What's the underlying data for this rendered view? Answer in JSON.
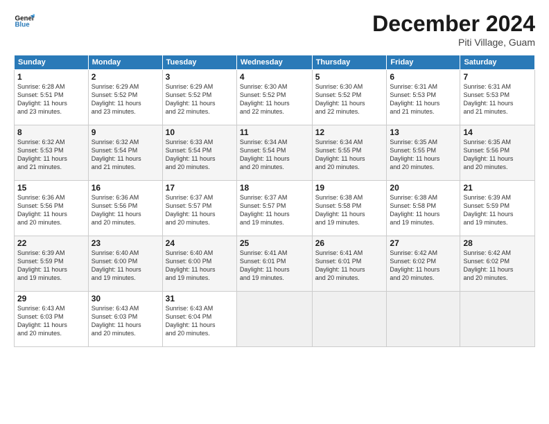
{
  "header": {
    "logo_line1": "General",
    "logo_line2": "Blue",
    "month_title": "December 2024",
    "location": "Piti Village, Guam"
  },
  "days_of_week": [
    "Sunday",
    "Monday",
    "Tuesday",
    "Wednesday",
    "Thursday",
    "Friday",
    "Saturday"
  ],
  "weeks": [
    [
      {
        "day": "1",
        "info": "Sunrise: 6:28 AM\nSunset: 5:51 PM\nDaylight: 11 hours\nand 23 minutes."
      },
      {
        "day": "2",
        "info": "Sunrise: 6:29 AM\nSunset: 5:52 PM\nDaylight: 11 hours\nand 23 minutes."
      },
      {
        "day": "3",
        "info": "Sunrise: 6:29 AM\nSunset: 5:52 PM\nDaylight: 11 hours\nand 22 minutes."
      },
      {
        "day": "4",
        "info": "Sunrise: 6:30 AM\nSunset: 5:52 PM\nDaylight: 11 hours\nand 22 minutes."
      },
      {
        "day": "5",
        "info": "Sunrise: 6:30 AM\nSunset: 5:52 PM\nDaylight: 11 hours\nand 22 minutes."
      },
      {
        "day": "6",
        "info": "Sunrise: 6:31 AM\nSunset: 5:53 PM\nDaylight: 11 hours\nand 21 minutes."
      },
      {
        "day": "7",
        "info": "Sunrise: 6:31 AM\nSunset: 5:53 PM\nDaylight: 11 hours\nand 21 minutes."
      }
    ],
    [
      {
        "day": "8",
        "info": "Sunrise: 6:32 AM\nSunset: 5:53 PM\nDaylight: 11 hours\nand 21 minutes."
      },
      {
        "day": "9",
        "info": "Sunrise: 6:32 AM\nSunset: 5:54 PM\nDaylight: 11 hours\nand 21 minutes."
      },
      {
        "day": "10",
        "info": "Sunrise: 6:33 AM\nSunset: 5:54 PM\nDaylight: 11 hours\nand 20 minutes."
      },
      {
        "day": "11",
        "info": "Sunrise: 6:34 AM\nSunset: 5:54 PM\nDaylight: 11 hours\nand 20 minutes."
      },
      {
        "day": "12",
        "info": "Sunrise: 6:34 AM\nSunset: 5:55 PM\nDaylight: 11 hours\nand 20 minutes."
      },
      {
        "day": "13",
        "info": "Sunrise: 6:35 AM\nSunset: 5:55 PM\nDaylight: 11 hours\nand 20 minutes."
      },
      {
        "day": "14",
        "info": "Sunrise: 6:35 AM\nSunset: 5:56 PM\nDaylight: 11 hours\nand 20 minutes."
      }
    ],
    [
      {
        "day": "15",
        "info": "Sunrise: 6:36 AM\nSunset: 5:56 PM\nDaylight: 11 hours\nand 20 minutes."
      },
      {
        "day": "16",
        "info": "Sunrise: 6:36 AM\nSunset: 5:56 PM\nDaylight: 11 hours\nand 20 minutes."
      },
      {
        "day": "17",
        "info": "Sunrise: 6:37 AM\nSunset: 5:57 PM\nDaylight: 11 hours\nand 20 minutes."
      },
      {
        "day": "18",
        "info": "Sunrise: 6:37 AM\nSunset: 5:57 PM\nDaylight: 11 hours\nand 19 minutes."
      },
      {
        "day": "19",
        "info": "Sunrise: 6:38 AM\nSunset: 5:58 PM\nDaylight: 11 hours\nand 19 minutes."
      },
      {
        "day": "20",
        "info": "Sunrise: 6:38 AM\nSunset: 5:58 PM\nDaylight: 11 hours\nand 19 minutes."
      },
      {
        "day": "21",
        "info": "Sunrise: 6:39 AM\nSunset: 5:59 PM\nDaylight: 11 hours\nand 19 minutes."
      }
    ],
    [
      {
        "day": "22",
        "info": "Sunrise: 6:39 AM\nSunset: 5:59 PM\nDaylight: 11 hours\nand 19 minutes."
      },
      {
        "day": "23",
        "info": "Sunrise: 6:40 AM\nSunset: 6:00 PM\nDaylight: 11 hours\nand 19 minutes."
      },
      {
        "day": "24",
        "info": "Sunrise: 6:40 AM\nSunset: 6:00 PM\nDaylight: 11 hours\nand 19 minutes."
      },
      {
        "day": "25",
        "info": "Sunrise: 6:41 AM\nSunset: 6:01 PM\nDaylight: 11 hours\nand 19 minutes."
      },
      {
        "day": "26",
        "info": "Sunrise: 6:41 AM\nSunset: 6:01 PM\nDaylight: 11 hours\nand 20 minutes."
      },
      {
        "day": "27",
        "info": "Sunrise: 6:42 AM\nSunset: 6:02 PM\nDaylight: 11 hours\nand 20 minutes."
      },
      {
        "day": "28",
        "info": "Sunrise: 6:42 AM\nSunset: 6:02 PM\nDaylight: 11 hours\nand 20 minutes."
      }
    ],
    [
      {
        "day": "29",
        "info": "Sunrise: 6:43 AM\nSunset: 6:03 PM\nDaylight: 11 hours\nand 20 minutes."
      },
      {
        "day": "30",
        "info": "Sunrise: 6:43 AM\nSunset: 6:03 PM\nDaylight: 11 hours\nand 20 minutes."
      },
      {
        "day": "31",
        "info": "Sunrise: 6:43 AM\nSunset: 6:04 PM\nDaylight: 11 hours\nand 20 minutes."
      },
      {
        "day": "",
        "info": ""
      },
      {
        "day": "",
        "info": ""
      },
      {
        "day": "",
        "info": ""
      },
      {
        "day": "",
        "info": ""
      }
    ]
  ]
}
